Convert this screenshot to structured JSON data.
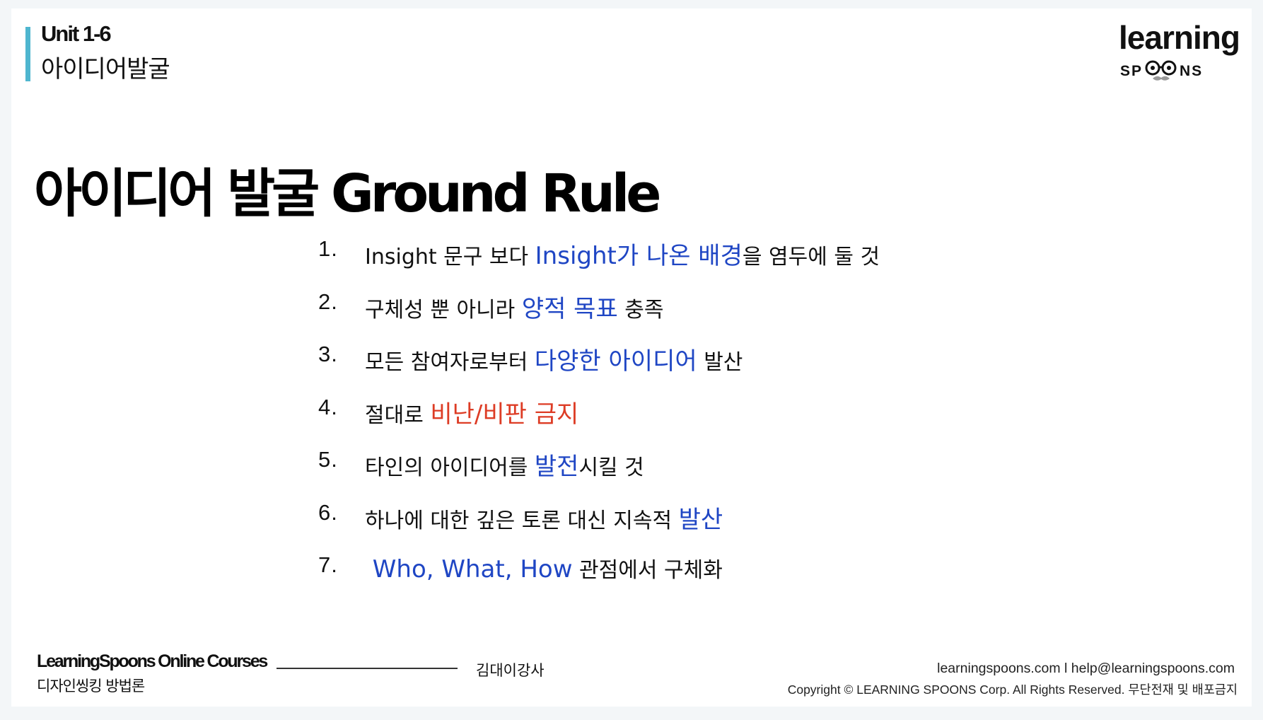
{
  "header": {
    "unit_code": "Unit 1-6",
    "unit_title": "아이디어발굴",
    "accent_color": "#4fb6cf"
  },
  "logo": {
    "top_text": "learning",
    "bottom_left": "SP",
    "bottom_right": "NS"
  },
  "main": {
    "title": "아이디어 발굴 Ground Rule",
    "rules": [
      {
        "number": "1.",
        "segments": [
          {
            "text": "Insight 문구 보다 ",
            "style": "normal"
          },
          {
            "text": "Insight가 나온 배경",
            "style": "blue"
          },
          {
            "text": "을 염두에 둘 것",
            "style": "normal"
          }
        ]
      },
      {
        "number": "2.",
        "segments": [
          {
            "text": "구체성 뿐 아니라 ",
            "style": "normal"
          },
          {
            "text": "양적 목표",
            "style": "blue"
          },
          {
            "text": " 충족",
            "style": "normal"
          }
        ]
      },
      {
        "number": "3.",
        "segments": [
          {
            "text": "모든 참여자로부터 ",
            "style": "normal"
          },
          {
            "text": "다양한 아이디어",
            "style": "blue"
          },
          {
            "text": " 발산",
            "style": "normal"
          }
        ]
      },
      {
        "number": "4.",
        "segments": [
          {
            "text": "절대로 ",
            "style": "normal"
          },
          {
            "text": "비난/비판 금지",
            "style": "red"
          }
        ]
      },
      {
        "number": "5.",
        "segments": [
          {
            "text": "타인의 아이디어를 ",
            "style": "normal"
          },
          {
            "text": "발전",
            "style": "blue"
          },
          {
            "text": "시킬 것",
            "style": "normal"
          }
        ]
      },
      {
        "number": "6.",
        "segments": [
          {
            "text": "하나에 대한 깊은 토론 대신 지속적 ",
            "style": "normal"
          },
          {
            "text": "발산",
            "style": "blue"
          }
        ]
      },
      {
        "number": "7.",
        "segments": [
          {
            "text": " Who, What, How",
            "style": "blue"
          },
          {
            "text": " 관점에서 구체화",
            "style": "normal"
          }
        ]
      }
    ],
    "colors": {
      "blue": "#1f46c4",
      "red": "#dd3c25"
    }
  },
  "footer": {
    "brand": "LearningSpoons Online Courses",
    "course": "디자인씽킹 방법론",
    "instructor": "김대이강사",
    "contact": "learningspoons.com l  help@learningspoons.com",
    "copyright": "Copyright © LEARNING SPOONS Corp. All Rights Reserved. 무단전재 및 배포금지"
  }
}
